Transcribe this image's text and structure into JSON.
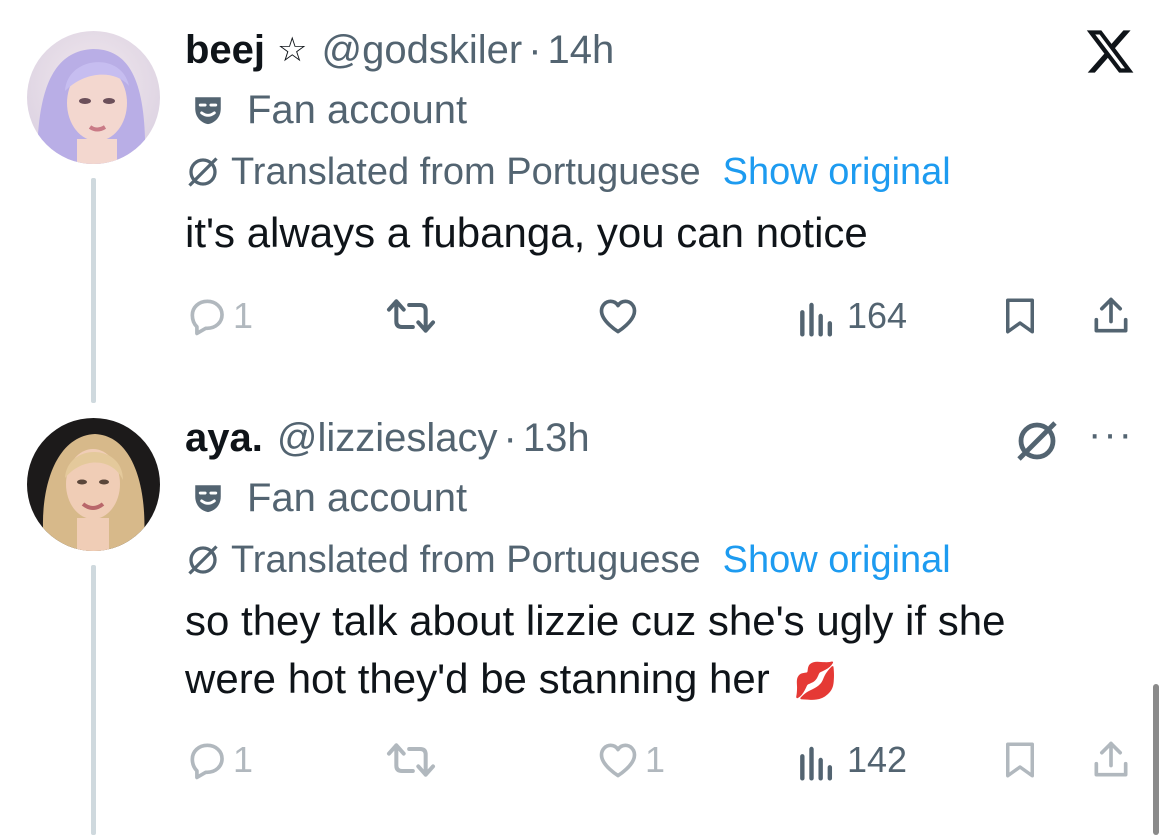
{
  "tweets": [
    {
      "display_name": "beej",
      "badge_glyph": "☆",
      "handle": "@godskiler",
      "separator": "·",
      "time": "14h",
      "label": "Fan account",
      "translation_note": "Translated from Portuguese",
      "show_original": "Show original",
      "text": "it's always a fubanga, you can notice",
      "reply_count": "1",
      "repost_count": "",
      "like_count": "",
      "view_count": "164",
      "icons": [
        "reply-icon",
        "repost-icon",
        "like-icon",
        "views-icon",
        "bookmark-icon",
        "share-icon"
      ]
    },
    {
      "display_name": "aya.",
      "handle": "@lizzieslacy",
      "separator": "·",
      "time": "13h",
      "label": "Fan account",
      "translation_note": "Translated from Portuguese",
      "show_original": "Show original",
      "text_line1": "so they talk about lizzie cuz she's ugly if she",
      "text_line2": "were hot they'd be stanning her",
      "emoji": "💋",
      "more_glyph": "···",
      "reply_count": "1",
      "repost_count": "",
      "like_count": "1",
      "view_count": "142"
    }
  ],
  "colors": {
    "primary_text": "#0f1419",
    "secondary_text": "#536471",
    "link": "#1d9bf0",
    "thread_line": "#cfd9de"
  }
}
